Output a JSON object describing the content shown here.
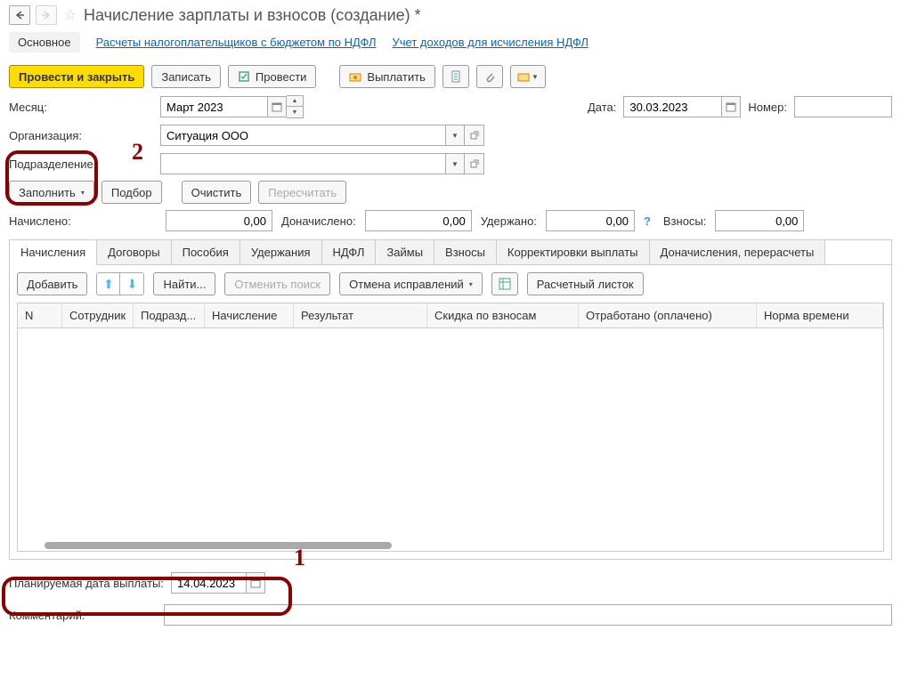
{
  "header": {
    "title": "Начисление зарплаты и взносов (создание) *"
  },
  "link_tabs": {
    "main": "Основное",
    "ndfl_calc": "Расчеты налогоплательщиков с бюджетом по НДФЛ",
    "ndfl_income": "Учет доходов для исчисления НДФЛ"
  },
  "cmdbar": {
    "post_close": "Провести и закрыть",
    "save": "Записать",
    "post": "Провести",
    "payout": "Выплатить"
  },
  "fields": {
    "month_label": "Месяц:",
    "month_value": "Март 2023",
    "date_label": "Дата:",
    "date_value": "30.03.2023",
    "number_label": "Номер:",
    "number_value": "",
    "org_label": "Организация:",
    "org_value": "Ситуация ООО",
    "dept_label": "Подразделение:",
    "dept_value": "",
    "fill": "Заполнить",
    "pick": "Подбор",
    "clear": "Очистить",
    "recalc": "Пересчитать",
    "accrued_label": "Начислено:",
    "accrued_value": "0,00",
    "extra_label": "Доначислено:",
    "extra_value": "0,00",
    "withheld_label": "Удержано:",
    "withheld_value": "0,00",
    "contrib_label": "Взносы:",
    "contrib_value": "0,00"
  },
  "subtabs": [
    "Начисления",
    "Договоры",
    "Пособия",
    "Удержания",
    "НДФЛ",
    "Займы",
    "Взносы",
    "Корректировки выплаты",
    "Доначисления, перерасчеты"
  ],
  "innerbar": {
    "add": "Добавить",
    "find": "Найти...",
    "cancel_find": "Отменить поиск",
    "cancel_fix": "Отмена исправлений",
    "payslip": "Расчетный листок"
  },
  "columns": [
    "N",
    "Сотрудник",
    "Подразд...",
    "Начисление",
    "Результат",
    "Скидка по взносам",
    "Отработано (оплачено)",
    "Норма времени"
  ],
  "bottom": {
    "planned_label": "Планируемая дата выплаты:",
    "planned_value": "14.04.2023",
    "comment_label": "Комментарий:",
    "comment_value": ""
  },
  "anno": {
    "n1": "1",
    "n2": "2"
  }
}
